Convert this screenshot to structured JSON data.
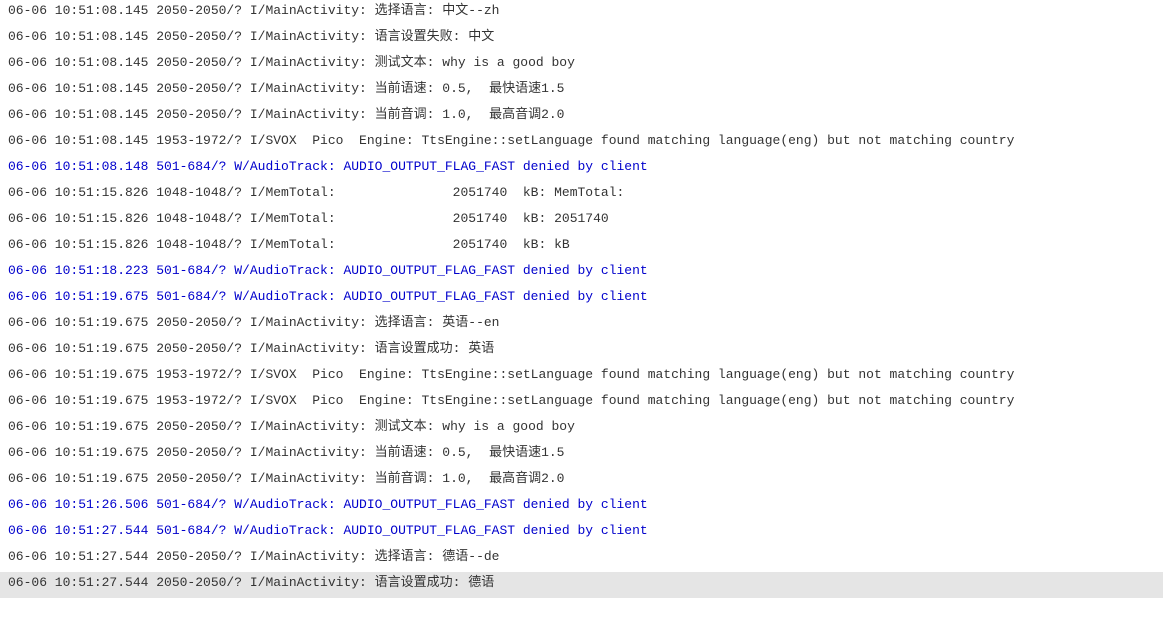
{
  "logs": [
    {
      "level": "info",
      "selected": false,
      "text": "06-06 10:51:08.145 2050-2050/? I/MainActivity: 选择语言: 中文--zh"
    },
    {
      "level": "info",
      "selected": false,
      "text": "06-06 10:51:08.145 2050-2050/? I/MainActivity: 语言设置失败: 中文"
    },
    {
      "level": "info",
      "selected": false,
      "text": "06-06 10:51:08.145 2050-2050/? I/MainActivity: 测试文本: why is a good boy"
    },
    {
      "level": "info",
      "selected": false,
      "text": "06-06 10:51:08.145 2050-2050/? I/MainActivity: 当前语速: 0.5,  最快语速1.5"
    },
    {
      "level": "info",
      "selected": false,
      "text": "06-06 10:51:08.145 2050-2050/? I/MainActivity: 当前音调: 1.0,  最高音调2.0"
    },
    {
      "level": "info",
      "selected": false,
      "text": "06-06 10:51:08.145 1953-1972/? I/SVOX  Pico  Engine: TtsEngine::setLanguage found matching language(eng) but not matching country"
    },
    {
      "level": "warning",
      "selected": false,
      "text": "06-06 10:51:08.148 501-684/? W/AudioTrack: AUDIO_OUTPUT_FLAG_FAST denied by client"
    },
    {
      "level": "info",
      "selected": false,
      "text": "06-06 10:51:15.826 1048-1048/? I/MemTotal:               2051740  kB: MemTotal:"
    },
    {
      "level": "info",
      "selected": false,
      "text": "06-06 10:51:15.826 1048-1048/? I/MemTotal:               2051740  kB: 2051740"
    },
    {
      "level": "info",
      "selected": false,
      "text": "06-06 10:51:15.826 1048-1048/? I/MemTotal:               2051740  kB: kB"
    },
    {
      "level": "warning",
      "selected": false,
      "text": "06-06 10:51:18.223 501-684/? W/AudioTrack: AUDIO_OUTPUT_FLAG_FAST denied by client"
    },
    {
      "level": "warning",
      "selected": false,
      "text": "06-06 10:51:19.675 501-684/? W/AudioTrack: AUDIO_OUTPUT_FLAG_FAST denied by client"
    },
    {
      "level": "info",
      "selected": false,
      "text": "06-06 10:51:19.675 2050-2050/? I/MainActivity: 选择语言: 英语--en"
    },
    {
      "level": "info",
      "selected": false,
      "text": "06-06 10:51:19.675 2050-2050/? I/MainActivity: 语言设置成功: 英语"
    },
    {
      "level": "info",
      "selected": false,
      "text": "06-06 10:51:19.675 1953-1972/? I/SVOX  Pico  Engine: TtsEngine::setLanguage found matching language(eng) but not matching country"
    },
    {
      "level": "info",
      "selected": false,
      "text": "06-06 10:51:19.675 1953-1972/? I/SVOX  Pico  Engine: TtsEngine::setLanguage found matching language(eng) but not matching country"
    },
    {
      "level": "info",
      "selected": false,
      "text": "06-06 10:51:19.675 2050-2050/? I/MainActivity: 测试文本: why is a good boy"
    },
    {
      "level": "info",
      "selected": false,
      "text": "06-06 10:51:19.675 2050-2050/? I/MainActivity: 当前语速: 0.5,  最快语速1.5"
    },
    {
      "level": "info",
      "selected": false,
      "text": "06-06 10:51:19.675 2050-2050/? I/MainActivity: 当前音调: 1.0,  最高音调2.0"
    },
    {
      "level": "warning",
      "selected": false,
      "text": "06-06 10:51:26.506 501-684/? W/AudioTrack: AUDIO_OUTPUT_FLAG_FAST denied by client"
    },
    {
      "level": "warning",
      "selected": false,
      "text": "06-06 10:51:27.544 501-684/? W/AudioTrack: AUDIO_OUTPUT_FLAG_FAST denied by client"
    },
    {
      "level": "info",
      "selected": false,
      "text": "06-06 10:51:27.544 2050-2050/? I/MainActivity: 选择语言: 德语--de"
    },
    {
      "level": "info",
      "selected": true,
      "text": "06-06 10:51:27.544 2050-2050/? I/MainActivity: 语言设置成功: 德语"
    }
  ]
}
